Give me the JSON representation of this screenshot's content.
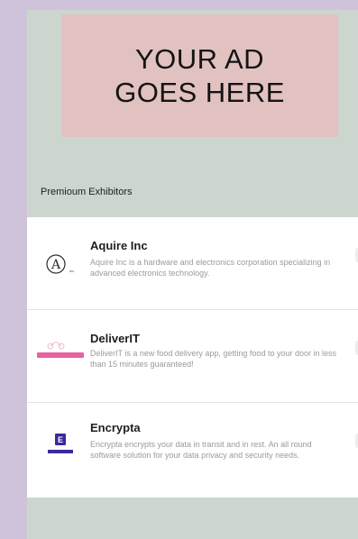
{
  "ad": {
    "text": "YOUR AD GOES HERE"
  },
  "section": {
    "title": "Premioum Exhibitors"
  },
  "exhibitors": [
    {
      "name": "Aquire Inc",
      "description": "Aquire Inc is a hardware and electronics corporation specializing in advanced electronics technology.",
      "logo_icon": "aquire-logo-icon"
    },
    {
      "name": "DeliverIT",
      "description": "DeliverIT is a new food delivery app, getting food to your door in less than 15 minutes guaranteed!",
      "logo_icon": "deliverit-logo-icon"
    },
    {
      "name": "Encrypta",
      "description": "Encrypta encrypts your data in transit and in rest. An all round software solution for your data privacy and security needs.",
      "logo_icon": "encrypta-logo-icon"
    }
  ],
  "colors": {
    "frame": "#cfc3dc",
    "screen": "#ccd6cf",
    "ad_background": "#e2c2c0",
    "deliverit_brand": "#e3478f",
    "encrypta_brand": "#3a2a9a"
  }
}
